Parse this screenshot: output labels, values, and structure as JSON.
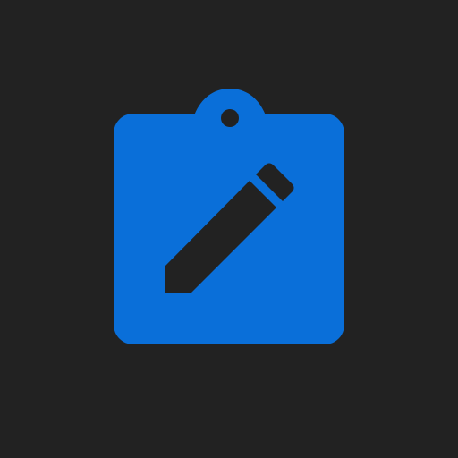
{
  "app_icon": {
    "name": "clipboard-edit",
    "background_color": "#222222",
    "clipboard_color": "#0A6FD9",
    "pencil_color": "#222222"
  }
}
